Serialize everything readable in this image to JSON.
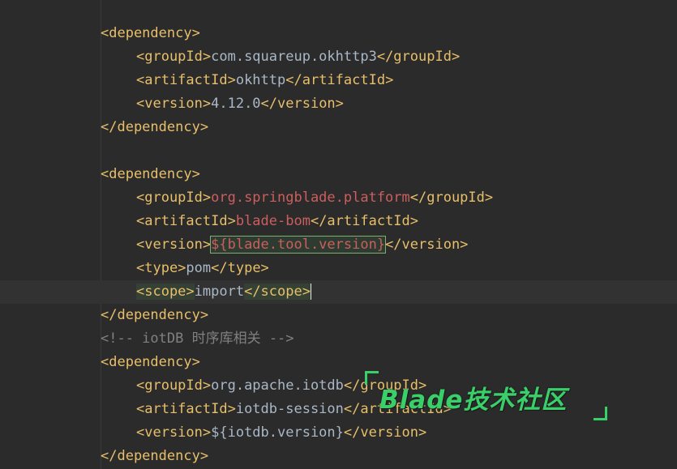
{
  "editor": {
    "dep1": {
      "open": "<dependency>",
      "group_open": "<groupId>",
      "group": "com.squareup.okhttp3",
      "group_close": "</groupId>",
      "artifact_open": "<artifactId>",
      "artifact": "okhttp",
      "artifact_close": "</artifactId>",
      "version_open": "<version>",
      "version": "4.12.0",
      "version_close": "</version>",
      "close": "</dependency>"
    },
    "dep2": {
      "open": "<dependency>",
      "group_open": "<groupId>",
      "group": "org.springblade.platform",
      "group_close": "</groupId>",
      "artifact_open": "<artifactId>",
      "artifact": "blade-bom",
      "artifact_close": "</artifactId>",
      "version_open": "<version>",
      "version": "${blade.tool.version}",
      "version_close": "</version>",
      "type_open": "<type>",
      "type": "pom",
      "type_close": "</type>",
      "scope_open": "<scope>",
      "scope": "import",
      "scope_close": "</scope>",
      "close": "</dependency>"
    },
    "comment": "<!-- iotDB 时序库相关 -->",
    "dep3": {
      "open": "<dependency>",
      "group_open": "<groupId>",
      "group": "org.apache.iotdb",
      "group_close": "</groupId>",
      "artifact_open": "<artifactId>",
      "artifact": "iotdb-session",
      "artifact_close": "</artifactId>",
      "version_open": "<version>",
      "version": "${iotdb.version}",
      "version_close": "</version>",
      "close": "</dependency>"
    }
  },
  "watermark": {
    "text": "Blade技术社区",
    "color": "#39d06a"
  },
  "colors": {
    "background": "#2b2b2b",
    "tag": "#e8bf6a",
    "text": "#a9b7c6",
    "property": "#cc5e5e",
    "comment": "#808080"
  }
}
